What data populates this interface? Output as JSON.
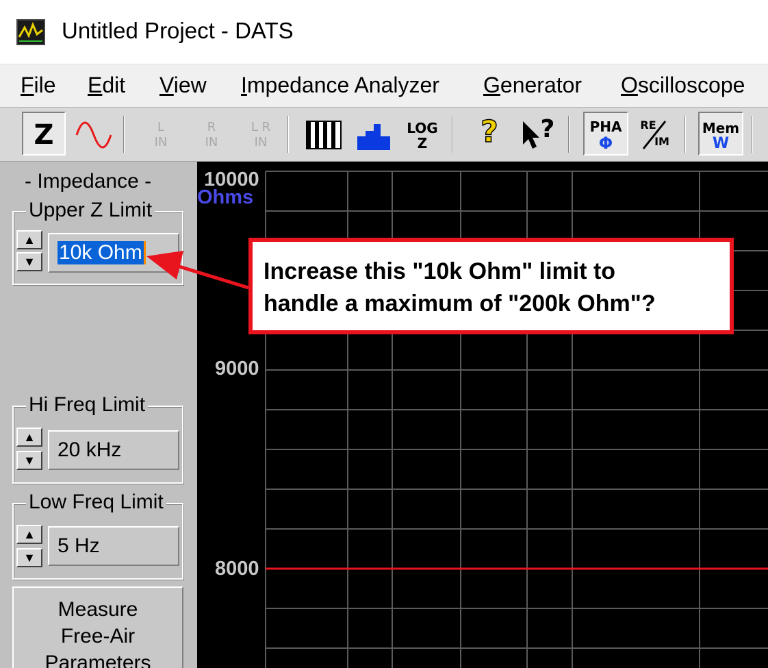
{
  "window": {
    "title": "Untitled Project - DATS"
  },
  "menu": [
    {
      "label": "File",
      "mnemonic": "F",
      "rest": "ile"
    },
    {
      "label": "Edit",
      "mnemonic": "E",
      "rest": "dit"
    },
    {
      "label": "View",
      "mnemonic": "V",
      "rest": "iew"
    },
    {
      "label": "Impedance Analyzer",
      "mnemonic": "I",
      "rest": "mpedance Analyzer"
    },
    {
      "label": "Generator",
      "mnemonic": "G",
      "rest": "enerator"
    },
    {
      "label": "Oscilloscope",
      "mnemonic": "O",
      "rest": "scilloscope"
    }
  ],
  "toolbar": {
    "impedance": "Z",
    "left_in": [
      "L",
      "IN"
    ],
    "right_in": [
      "R",
      "IN"
    ],
    "lr_in": [
      "L R",
      "IN"
    ],
    "log": [
      "LOG",
      "Z"
    ],
    "help": "?",
    "context_help": "?",
    "phase": [
      "PHA",
      "Φ"
    ],
    "reim": [
      "RE",
      "IM"
    ],
    "mem": [
      "Mem",
      "W"
    ]
  },
  "panel": {
    "header": "- Impedance -",
    "upper_z": {
      "label": "Upper Z Limit",
      "value": "10k Ohm"
    },
    "hi_freq": {
      "label": "Hi Freq Limit",
      "value": "20 kHz"
    },
    "low_freq": {
      "label": "Low Freq Limit",
      "value": "5 Hz"
    },
    "measure_button": [
      "Measure",
      "Free-Air",
      "Parameters"
    ]
  },
  "chart_data": {
    "type": "line",
    "y_unit": "Ohms",
    "y_ticks": [
      "10000",
      "9000",
      "8000"
    ],
    "ylim": [
      7500,
      10000
    ],
    "series": [
      {
        "values": [
          8000,
          8000
        ],
        "color": "#e8141e"
      }
    ],
    "grid": true,
    "background": "#000000",
    "grid_color": "#5a5a5a"
  },
  "callout": {
    "line1": "Increase this \"10k Ohm\" limit to",
    "line2": "handle a maximum of \"200k Ohm\"?",
    "color": "#e8141e"
  }
}
